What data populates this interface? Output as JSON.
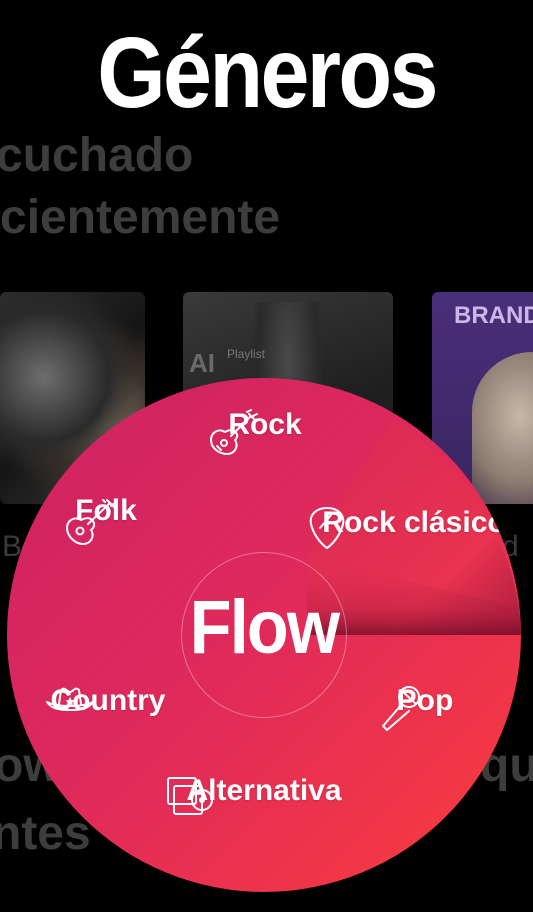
{
  "header": {
    "title": "Géneros"
  },
  "background": {
    "line1": "cuchado",
    "line2": "cientemente",
    "tile_ai": "AI",
    "tile_playlist": "Playlist",
    "tile_brand": "BRAND",
    "left_fragment": "B",
    "right_fragment": "d",
    "line3_left": "ow",
    "line3_right": "qu",
    "line4_left": "ntes"
  },
  "wheel": {
    "center_label": "Flow",
    "accent_start": "#cd2164",
    "accent_end": "#fb3d3c",
    "items": [
      {
        "label": "Rock",
        "icon": "guitar-icon"
      },
      {
        "label": "Rock clásico",
        "icon": "guitar-pick-icon"
      },
      {
        "label": "Pop",
        "icon": "microphone-icon"
      },
      {
        "label": "Alternativa",
        "icon": "albums-icon"
      },
      {
        "label": "Country",
        "icon": "cowboy-hat-icon"
      },
      {
        "label": "Folk",
        "icon": "acoustic-guitar-icon"
      }
    ]
  }
}
